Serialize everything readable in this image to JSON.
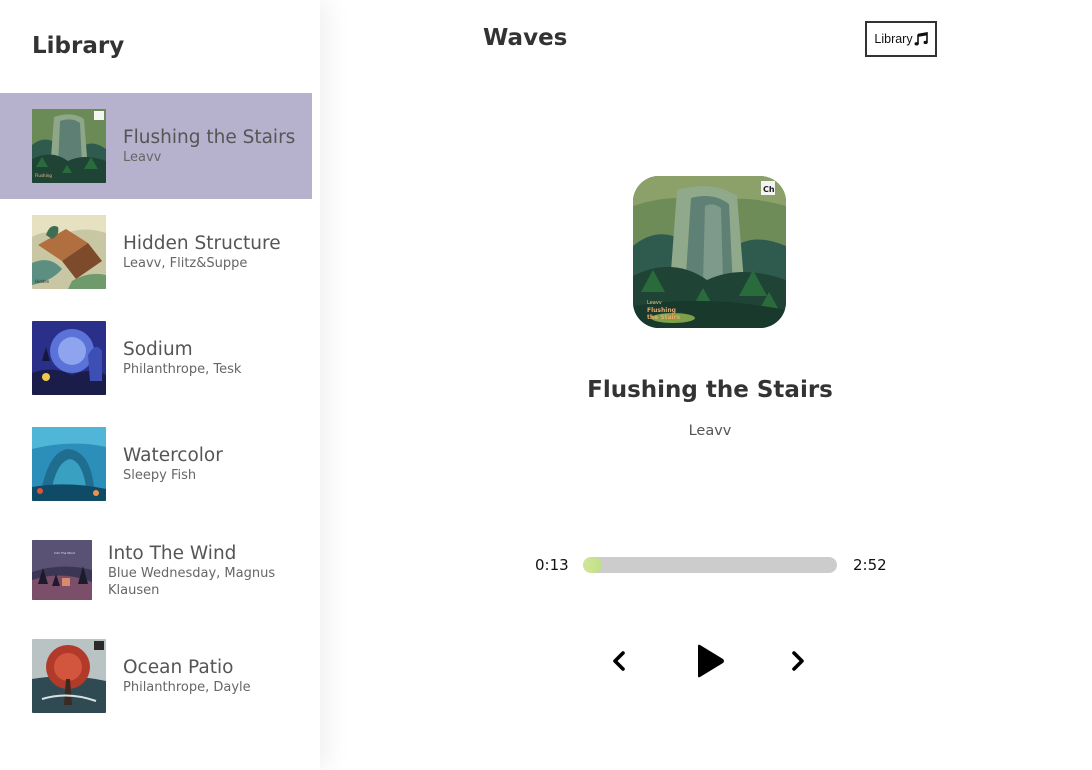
{
  "sidebar": {
    "title": "Library",
    "songs": [
      {
        "name": "Flushing the Stairs",
        "artist": "Leavv",
        "selected": true
      },
      {
        "name": "Hidden Structure",
        "artist": "Leavv, Flitz&Suppe"
      },
      {
        "name": "Sodium",
        "artist": "Philanthrope, Tesk"
      },
      {
        "name": "Watercolor",
        "artist": "Sleepy Fish"
      },
      {
        "name": "Into The Wind",
        "artist": "Blue Wednesday, Magnus Klausen"
      },
      {
        "name": "Ocean Patio",
        "artist": "Philanthrope, Dayle"
      }
    ]
  },
  "nav": {
    "title": "Waves",
    "library_button": "Library",
    "library_icon": "music-note-icon"
  },
  "player": {
    "title": "Flushing the Stairs",
    "artist": "Leavv",
    "current_time": "0:13",
    "total_time": "2:52",
    "progress_fraction": 0.076,
    "progress_color": "#c8e28f",
    "controls": [
      "prev-icon",
      "play-icon",
      "next-icon"
    ]
  },
  "colors": {
    "selected_bg": "#b6b2cd",
    "track_bg": "#cccccc",
    "text": "#333333"
  }
}
